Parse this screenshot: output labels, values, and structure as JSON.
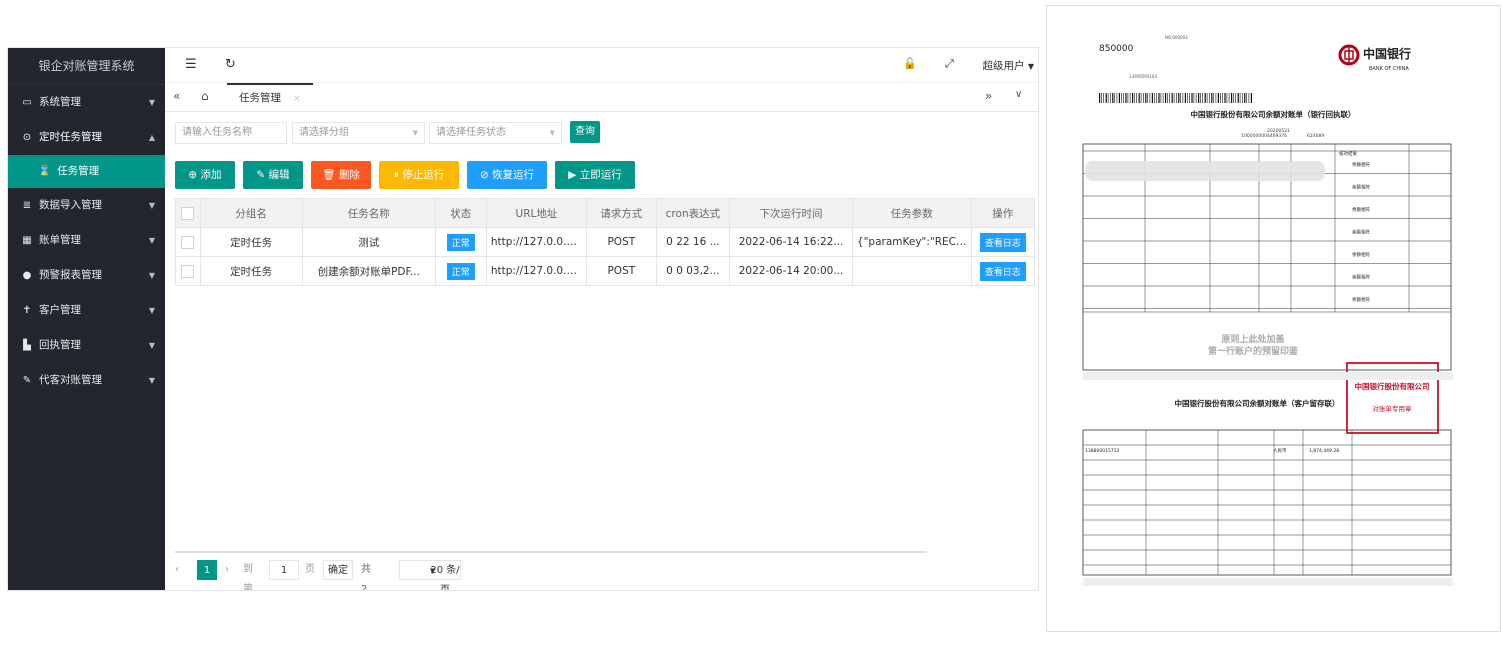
{
  "app": {
    "title": "银企对账管理系统"
  },
  "sidebar": {
    "items": [
      {
        "label": "系统管理",
        "icon": "monitor-icon",
        "glyph": "▭"
      },
      {
        "label": "定时任务管理",
        "icon": "clock-icon",
        "glyph": "⊙"
      },
      {
        "label": "数据导入管理",
        "icon": "database-icon",
        "glyph": "≣"
      },
      {
        "label": "账单管理",
        "icon": "grid-icon",
        "glyph": "▦"
      },
      {
        "label": "预警报表管理",
        "icon": "alert-icon",
        "glyph": "●"
      },
      {
        "label": "客户管理",
        "icon": "person-icon",
        "glyph": "✝"
      },
      {
        "label": "回执管理",
        "icon": "receipt-icon",
        "glyph": "▙"
      },
      {
        "label": "代客对账管理",
        "icon": "edit-icon",
        "glyph": "✎"
      }
    ],
    "sub_item": {
      "label": "任务管理",
      "glyph": "⌛"
    }
  },
  "topbar": {
    "user": "超级用户"
  },
  "tabs": {
    "active": "任务管理",
    "close": "×"
  },
  "filters": {
    "name_placeholder": "请输入任务名称",
    "group_placeholder": "请选择分组",
    "status_placeholder": "请选择任务状态",
    "query": "查询"
  },
  "actions": [
    {
      "label": "⊕ 添加",
      "color": "#009688"
    },
    {
      "label": "✎ 编辑",
      "color": "#009688"
    },
    {
      "label": "🗑 删除",
      "color": "#ff5722"
    },
    {
      "label": "⏸ 停止运行",
      "color": "#ffb800"
    },
    {
      "label": "⊘ 恢复运行",
      "color": "#1e9fff"
    },
    {
      "label": "▶ 立即运行",
      "color": "#009688"
    }
  ],
  "table": {
    "headers": [
      "分组名",
      "任务名称",
      "状态",
      "URL地址",
      "请求方式",
      "cron表达式",
      "下次运行时间",
      "任务参数",
      "操作"
    ],
    "rows": [
      {
        "group": "定时任务",
        "name": "测试",
        "status": "正常",
        "url": "http://127.0.0.1/...",
        "method": "POST",
        "cron": "0 22 16 ...",
        "next": "2022-06-14 16:22...",
        "params": "{\"paramKey\":\"RECEIPT",
        "action": "查看日志"
      },
      {
        "group": "定时任务",
        "name": "创建余额对账单PDF...",
        "status": "正常",
        "url": "http://127.0.0.1/...",
        "method": "POST",
        "cron": "0 0 03,2...",
        "next": "2022-06-14 20:00...",
        "params": "",
        "action": "查看日志"
      }
    ]
  },
  "pager": {
    "page": "1",
    "goto": "到第",
    "goto_value": "1",
    "page_unit": "页",
    "confirm": "确定",
    "total": "共 2 条",
    "size": "20 条/页"
  },
  "doc": {
    "code": "850000",
    "bank_cn": "中国银行",
    "bank_en": "BANK OF CHINA",
    "title1": "中国银行股份有限公司余额对账单（银行回执联）",
    "title2": "中国银行股份有限公司余额对账单（客户留存联）",
    "stamp_note": "原则上此处加盖第一行账户的预留印鉴",
    "seal_text": "中国银行股份有限公司",
    "seal_sub": "对账单专用章",
    "acct": "138800015712",
    "amount": "1,874,449.28",
    "currency": "人民币",
    "agreement": "1000000004469376",
    "date": "20200531",
    "cust_no": "624689",
    "phone": "13959595103",
    "check": "余额相符",
    "check_result": "核对结果"
  }
}
